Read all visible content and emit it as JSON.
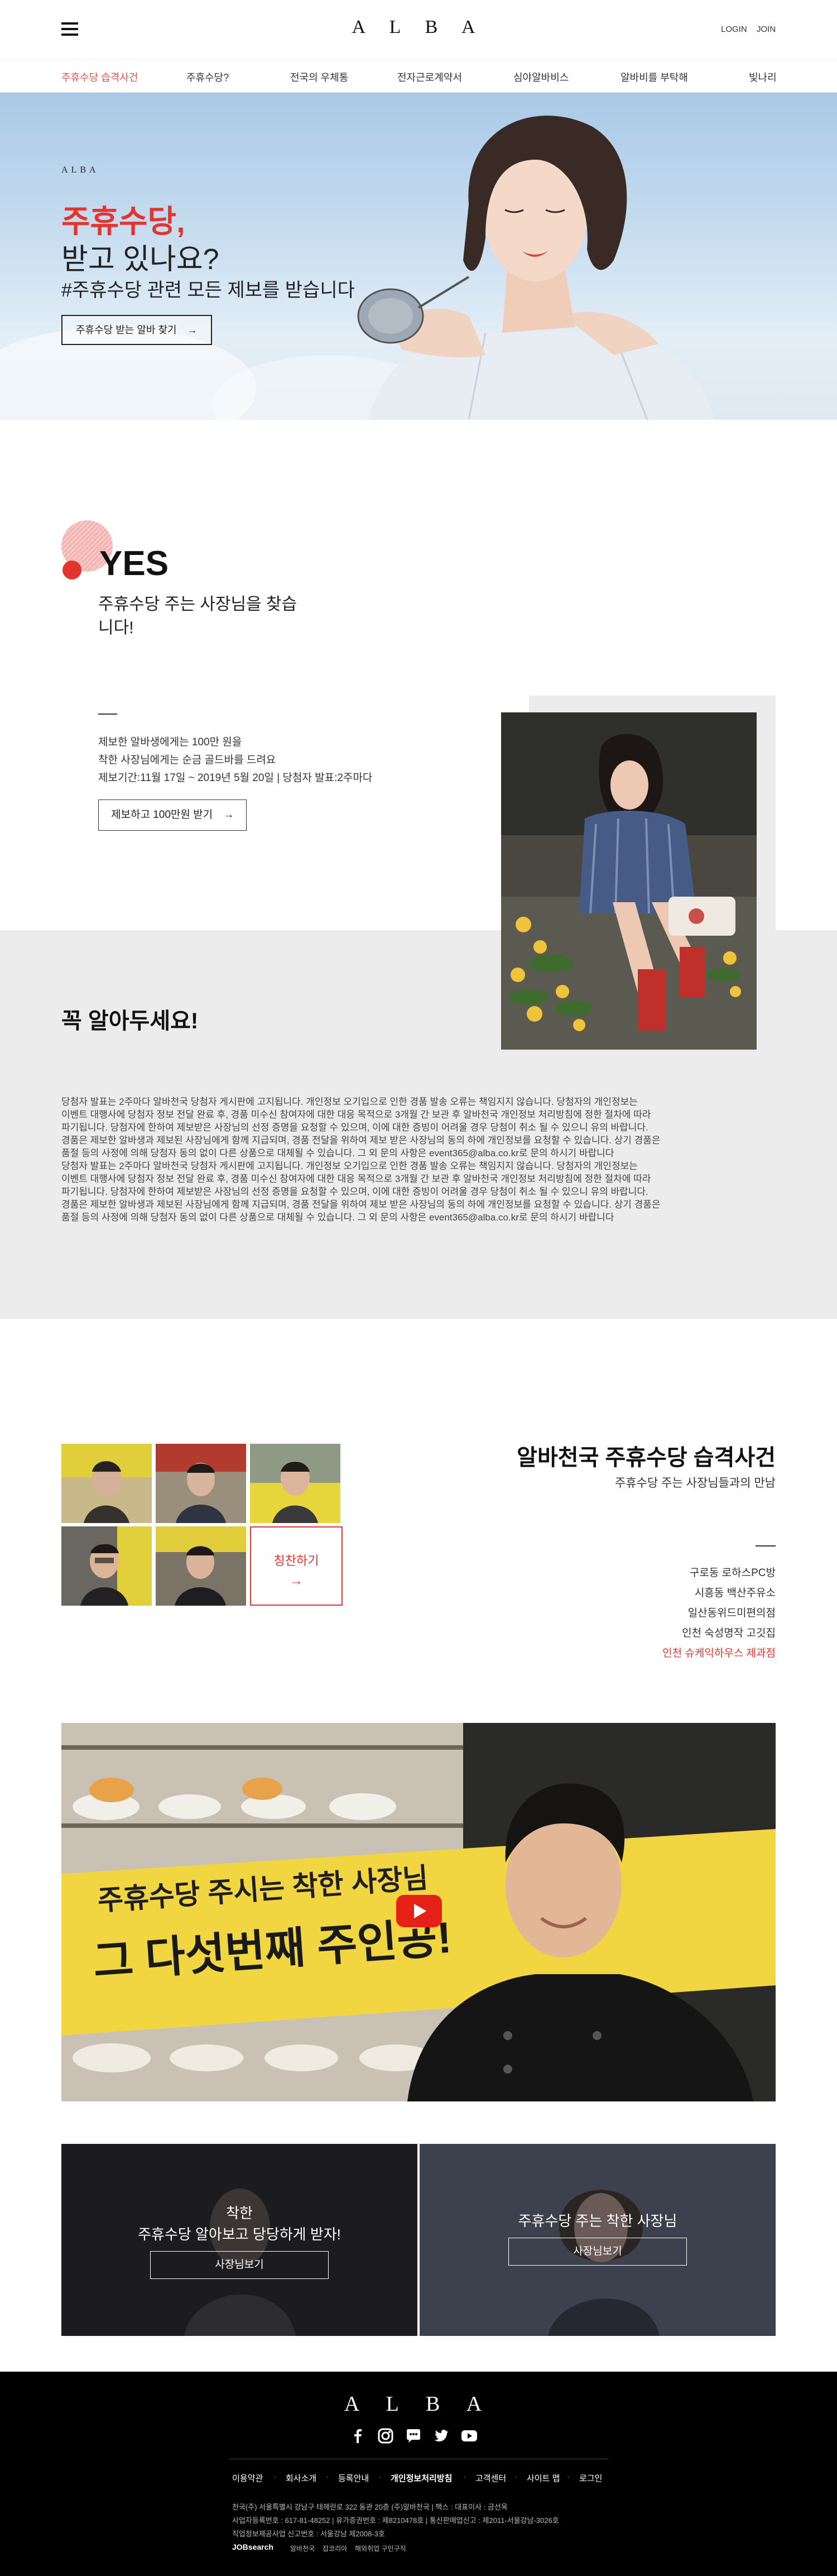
{
  "header": {
    "logo": "A L B A",
    "login": "LOGIN",
    "join": "JOIN"
  },
  "nav": {
    "items": [
      {
        "label": "주휴수당 습격사건",
        "active": true
      },
      {
        "label": "주휴수당?"
      },
      {
        "label": "전국의 우체통"
      },
      {
        "label": "전자근로계약서"
      },
      {
        "label": "심야알바비스"
      },
      {
        "label": "알바비를 부탁해"
      },
      {
        "label": "빛나리"
      }
    ]
  },
  "hero": {
    "kicker": "ALBA",
    "title_line1": "주휴수당,",
    "title_line2": "받고 있나요?",
    "subtitle": "#주휴수당 관련 모든 제보를 받습니다",
    "button": "주휴수당 받는 알바 찾기",
    "accent": "#e3342f"
  },
  "yes": {
    "title": "YES",
    "subtitle": "주휴수당 주는 사장님을 찾습니다!",
    "lines": [
      "제보한 알바생에게는 100만 원을",
      "착한 사장님에게는 순금 골드바를 드려요",
      "제보기간:11월 17일 ~ 2019년 5월 20일 | 당첨자 발표:2주마다"
    ],
    "button": "제보하고 100만원 받기"
  },
  "notice": {
    "title": "꼭 알아두세요!",
    "body": [
      "당첨자 발표는 2주마다 알바천국 당첨자 게시판에 고지됩니다. 개인정보 오기입으로 인한 경품 발송 오류는 책임지지 않습니다. 당첨자의 개인정보는",
      "이벤트 대행사에 당첨자 정보 전달 완료 후, 경품 미수신 참여자에 대한 대응 목적으로 3개월 간 보관 후 알바천국 개인정보 처리방침에 정한 절차에 따라",
      "파기됩니다. 당첨자에 한하여 제보받은 사장님의 선정 증명을 요청할 수 있으며, 이에 대한 증빙이 어려울 경우 당첨이 취소 될 수 있으니 유의 바랍니다.",
      "경품은 제보한 알바생과 제보된 사장님에게 함께 지급되며, 경품 전달을 위하여 제보 받은 사장님의 동의 하에 개인정보를 요청할 수 있습니다. 상기 경품은",
      "품절 등의 사정에 의해 당첨자 동의 없이 다른 상품으로 대체될 수 있습니다. 그 외 문의 사항은 event365@alba.co.kr로 문의 하시기 바랍니다",
      "당첨자 발표는 2주마다 알바천국 당첨자 게시판에 고지됩니다. 개인정보 오기입으로 인한 경품 발송 오류는 책임지지 않습니다. 당첨자의 개인정보는",
      "이벤트 대행사에 당첨자 정보 전달 완료 후, 경품 미수신 참여자에 대한 대응 목적으로 3개월 간 보관 후 알바천국 개인정보 처리방침에 정한 절차에 따라",
      "파기됩니다. 당첨자에 한하여 제보받은 사장님의 선정 증명을 요청할 수 있으며, 이에 대한 증빙이 어려울 경우 당첨이 취소 될 수 있으니 유의 바랍니다.",
      "경품은 제보한 알바생과 제보된 사장님에게 함께 지급되며, 경품 전달을 위하여 제보 받은 사장님의 동의 하에 개인정보를 요청할 수 있습니다. 상기 경품은",
      "품절 등의 사정에 의해 당첨자 동의 없이 다른 상품으로 대체될 수 있습니다. 그 외 문의 사항은 event365@alba.co.kr로 문의 하시기 바랍니다"
    ]
  },
  "owners": {
    "title": "알바천국 주휴수당 습격사건",
    "subtitle": "주휴수당 주는 사장님들과의 만남",
    "cta": "칭찬하기",
    "places": [
      {
        "label": "구로동 로하스PC방"
      },
      {
        "label": "시흥동 백산주유소"
      },
      {
        "label": "일산동위드미편의점"
      },
      {
        "label": "인천 숙성명작 고깃집"
      },
      {
        "label": "인천 슈케익하우스 제과점",
        "active": true
      }
    ]
  },
  "video": {
    "line1": "주휴수당 주시는 착한 사장님",
    "line2": "그 다섯번째 주인공!"
  },
  "promos": [
    {
      "lines": [
        "착한",
        "주휴수당 알아보고 당당하게 받자!"
      ],
      "button": "사장님보기"
    },
    {
      "lines": [
        "주휴수당 주는 착한 사장님"
      ],
      "button": "사장님보기"
    }
  ],
  "footer": {
    "logo": "A L B A",
    "links": [
      "이용약관",
      "회사소개",
      "등록안내",
      "개인정보처리방침",
      "고객센터",
      "사이트 맵",
      "로그인"
    ],
    "info": [
      "천국(주)  서울특별시 강남구 테헤란로 322 동관 20층 (주)알바천국 | 팩스 : 대표이사 : 금선옥",
      "사업자등록번호 : 617-81-48252 | 유가증권번호 : 제8210478호 | 통신판매업신고 : 제2011-서울강남-3026호",
      "직업정보제공사업 신고번호 : 서울강남 제2008-3호"
    ],
    "partners": [
      "JOBsearch",
      "알바천국",
      "잡코리아",
      "해외취업 구인구직"
    ]
  }
}
